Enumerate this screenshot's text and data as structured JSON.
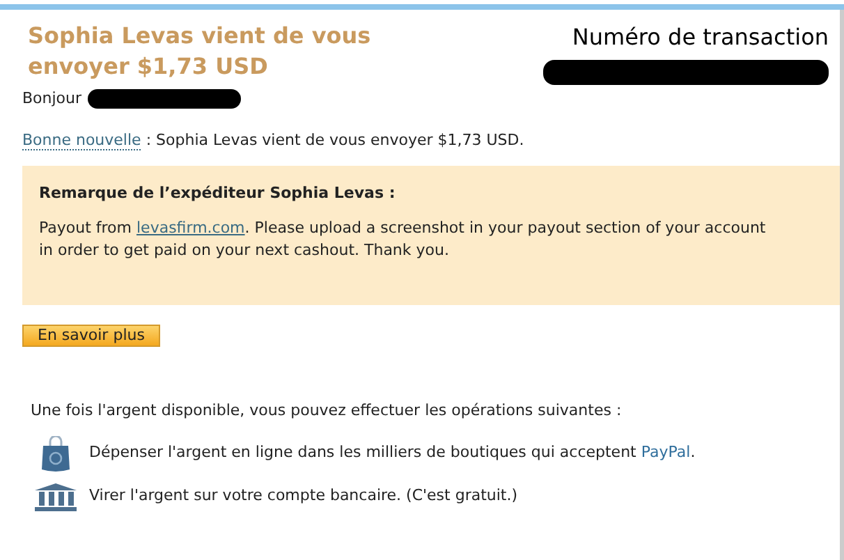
{
  "header": {
    "title": "Sophia Levas vient de vous envoyer $1,73 USD",
    "transaction_label": "Numéro de transaction",
    "transaction_redacted": true
  },
  "greeting": {
    "text": "Bonjour",
    "name_redacted": true
  },
  "news": {
    "link": "Bonne nouvelle",
    "text": " : Sophia Levas vient de vous envoyer $1,73 USD."
  },
  "note": {
    "title": "Remarque de l’expéditeur Sophia Levas :",
    "before": "Payout from ",
    "link": "levasfirm.com",
    "after": ". Please upload a screenshot in your payout section of your account in order to get paid on your next cashout. Thank you."
  },
  "button": "En savoir plus",
  "options": {
    "intro": "Une fois l'argent disponible, vous pouvez effectuer les opérations suivantes :",
    "items": [
      {
        "kind": "shop",
        "text": "Dépenser l'argent en ligne dans les milliers de boutiques qui acceptent ",
        "link": "PayPal",
        "after": "."
      },
      {
        "kind": "bank",
        "text": "Virer l'argent sur votre compte bancaire. (C'est gratuit.)"
      }
    ]
  }
}
